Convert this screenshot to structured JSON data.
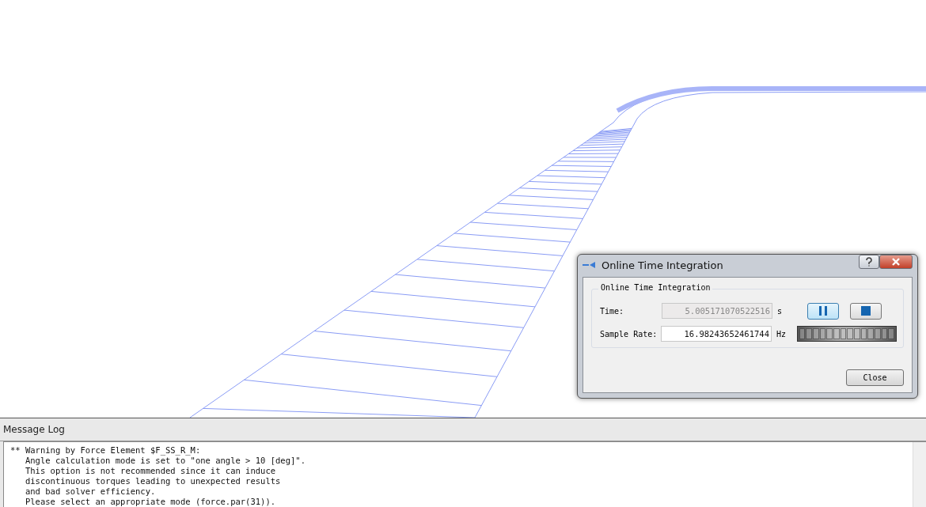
{
  "dialog": {
    "title": "Online Time Integration",
    "group_title": "Online Time Integration",
    "fields": [
      {
        "label": "Time:",
        "value": "5.005171070522516",
        "unit": "s",
        "disabled": true
      },
      {
        "label": "Sample Rate:",
        "value": "16.98243652461744",
        "unit": "Hz",
        "disabled": false
      }
    ],
    "close_button": "Close"
  },
  "message_log": {
    "title": "Message Log",
    "text": "** Warning by Force Element $F_SS_R_M:\n   Angle calculation mode is set to \"one angle > 10 [deg]\".\n   This option is not recommended since it can induce\n   discontinuous torques leading to unexpected results\n   and bad solver efficiency.\n   Please select an appropriate mode (force.par(31))."
  }
}
